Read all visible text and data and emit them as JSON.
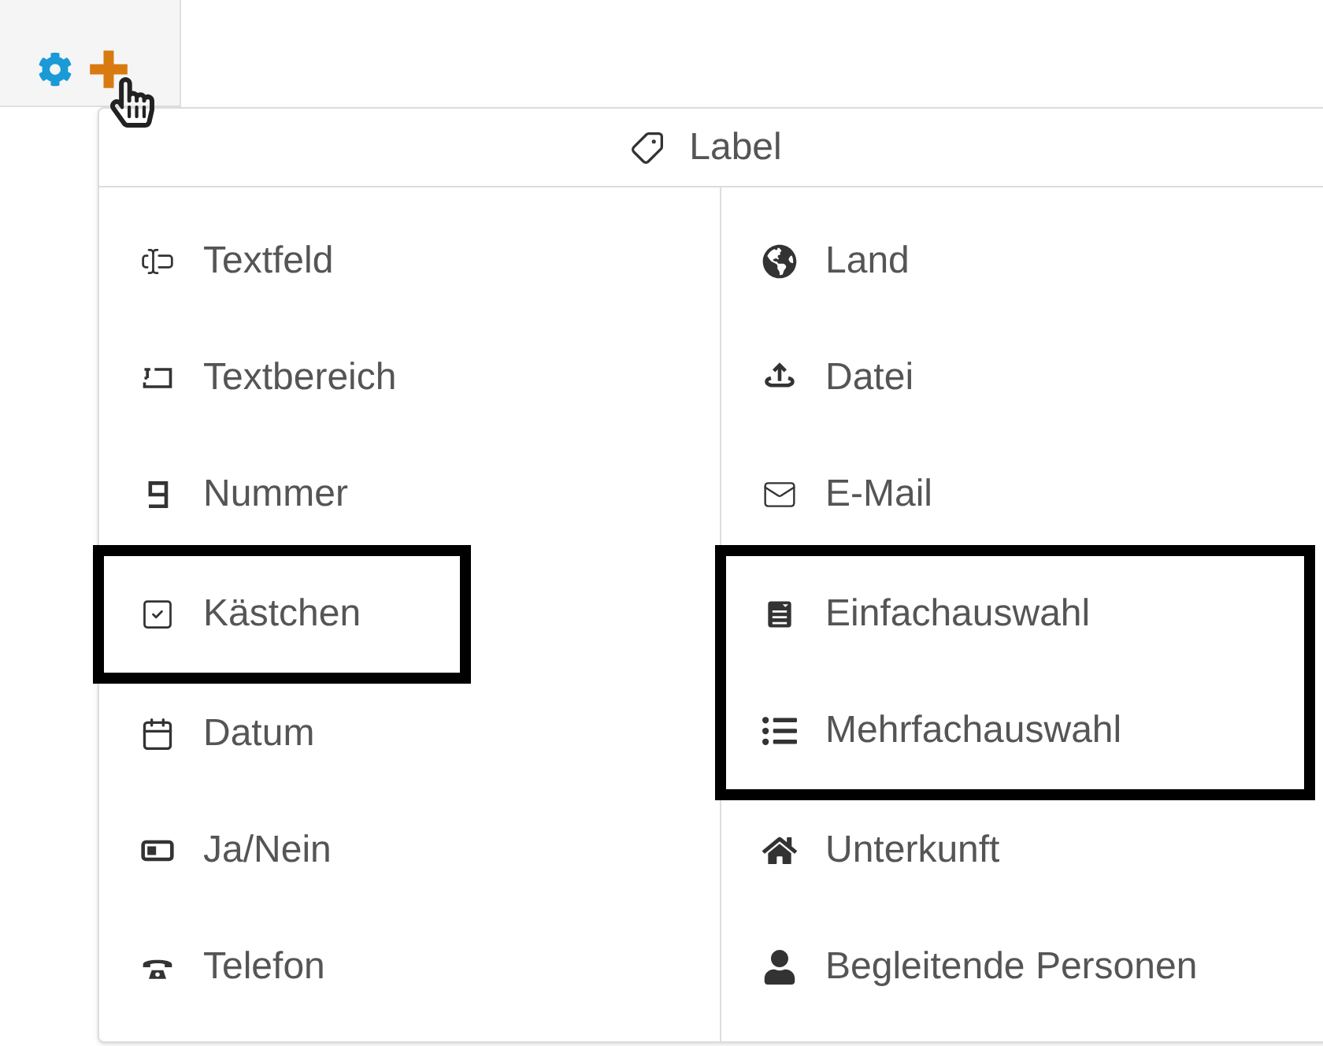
{
  "toolbar": {
    "buttons": [
      {
        "kind": "settings"
      },
      {
        "kind": "add"
      }
    ]
  },
  "menu": {
    "header": "Label",
    "columns": [
      [
        {
          "kind": "text",
          "label": "Textfeld",
          "highlighted": false
        },
        {
          "kind": "textarea",
          "label": "Textbereich",
          "highlighted": false
        },
        {
          "kind": "number",
          "label": "Nummer",
          "highlighted": false
        },
        {
          "kind": "checkbox",
          "label": "Kästchen",
          "highlighted": true
        },
        {
          "kind": "date",
          "label": "Datum",
          "highlighted": false
        },
        {
          "kind": "yesno",
          "label": "Ja/Nein",
          "highlighted": false
        },
        {
          "kind": "phone",
          "label": "Telefon",
          "highlighted": false
        }
      ],
      [
        {
          "kind": "country",
          "label": "Land",
          "highlighted": false
        },
        {
          "kind": "file",
          "label": "Datei",
          "highlighted": false
        },
        {
          "kind": "email",
          "label": "E-Mail",
          "highlighted": false
        },
        {
          "kind": "single",
          "label": "Einfachauswahl",
          "highlighted": true
        },
        {
          "kind": "multi",
          "label": "Mehrfachauswahl",
          "highlighted": true
        },
        {
          "kind": "accommodation",
          "label": "Unterkunft",
          "highlighted": false
        },
        {
          "kind": "companions",
          "label": "Begleitende Personen",
          "highlighted": false
        }
      ]
    ]
  }
}
